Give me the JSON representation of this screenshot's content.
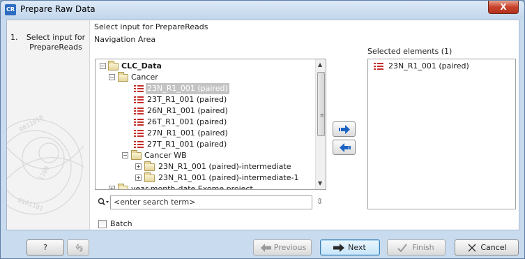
{
  "window": {
    "title": "Prepare Raw Data",
    "app_icon": "CR",
    "close_label": "X"
  },
  "steps": [
    {
      "number": "1.",
      "label": "Select input for PrepareReads"
    }
  ],
  "main": {
    "heading": "Select input for PrepareReads",
    "nav_label": "Navigation Area",
    "selected_label": "Selected elements (1)"
  },
  "tree": [
    {
      "label": "CLC_Data",
      "type": "root",
      "expander": "−"
    },
    {
      "label": "Cancer",
      "type": "folder",
      "expander": "−"
    },
    {
      "label": "23N_R1_001 (paired)",
      "type": "sequence",
      "selected": true
    },
    {
      "label": "23T_R1_001 (paired)",
      "type": "sequence"
    },
    {
      "label": "26N_R1_001 (paired)",
      "type": "sequence"
    },
    {
      "label": "26T_R1_001 (paired)",
      "type": "sequence"
    },
    {
      "label": "27N_R1_001 (paired)",
      "type": "sequence"
    },
    {
      "label": "27T_R1_001 (paired)",
      "type": "sequence"
    },
    {
      "label": "Cancer WB",
      "type": "folder",
      "expander": "−"
    },
    {
      "label": "23N_R1_001 (paired)-intermediate",
      "type": "folder",
      "expander": "+"
    },
    {
      "label": "23N_R1_001 (paired)-intermediate-1",
      "type": "folder",
      "expander": "+"
    },
    {
      "label": "year-month-date Exome project",
      "type": "folder",
      "expander": "+"
    }
  ],
  "search": {
    "placeholder": "<enter search term>"
  },
  "batch": {
    "label": "Batch",
    "checked": false
  },
  "selected_elements": [
    {
      "label": "23N_R1_001 (paired)",
      "type": "sequence"
    }
  ],
  "footer": {
    "help_label": "?",
    "previous_label": "Previous",
    "next_label": "Next",
    "finish_label": "Finish",
    "cancel_label": "Cancel"
  },
  "colors": {
    "sequence_icon": "#c4302b",
    "accent_blue": "#1d63c4",
    "window_frame": "#c9dbee"
  }
}
